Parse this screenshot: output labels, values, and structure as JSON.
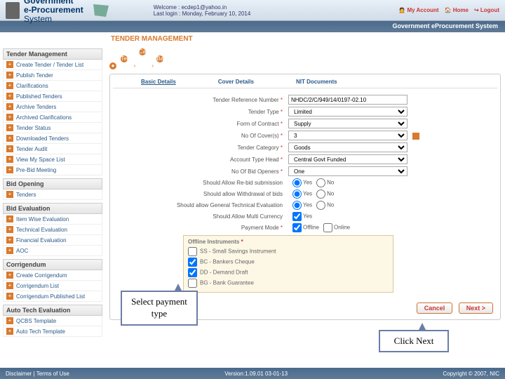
{
  "header": {
    "brand_l1": "Government",
    "brand_l2": "e-Procurement",
    "brand_l3": "System",
    "welcome_lbl": "Welcome",
    "welcome_val": "ecdep1@yahoo.in",
    "lastlogin_lbl": "Last login",
    "lastlogin_val": "Monday, February 10, 2014",
    "links": {
      "acct": "My Account",
      "home": "Home",
      "logout": "Logout"
    },
    "subhead": "Government eProcurement System"
  },
  "page_title": "TENDER MANAGEMENT",
  "sidebar": {
    "groups": [
      {
        "title": "Tender Management",
        "items": [
          "Create Tender / Tender List",
          "Publish Tender",
          "Clarifications",
          "Published Tenders",
          "Archive Tenders",
          "Archived Clarifications",
          "Tender Status",
          "Downloaded Tenders",
          "Tender Audit",
          "View My Space List",
          "Pre-Bid Meeting"
        ]
      },
      {
        "title": "Bid Opening",
        "items": [
          "Tenders"
        ]
      },
      {
        "title": "Bid Evaluation",
        "items": [
          "Item Wise Evaluation",
          "Technical Evaluation",
          "Financial Evaluation",
          "AOC"
        ]
      },
      {
        "title": "Corrigendum",
        "items": [
          "Create Corrigendum",
          "Corrigendum List",
          "Corrigendum Published List"
        ]
      },
      {
        "title": "Auto Tech Evaluation",
        "items": [
          "QCBS Template",
          "Auto Tech Template"
        ]
      }
    ]
  },
  "breadcrumb": [
    "Tender List",
    "Call For Tender",
    "Basic Details"
  ],
  "tabs": [
    "Basic Details",
    "Cover Details",
    "NIT Documents"
  ],
  "form": {
    "ref_lbl": "Tender Reference Number",
    "ref_val": "NHDC/2/C/949/14/0197-02.10",
    "type_lbl": "Tender Type",
    "type_val": "Limited",
    "contract_lbl": "Form of Contract",
    "contract_val": "Supply",
    "covers_lbl": "No Of Cover(s)",
    "covers_val": "3",
    "cat_lbl": "Tender Category",
    "cat_val": "Goods",
    "acct_lbl": "Account Type Head",
    "acct_val": "Central Govt Funded",
    "openers_lbl": "No Of Bid Openers",
    "openers_val": "One",
    "resub_lbl": "Should Allow Re-bid submission",
    "opt_yes": "Yes",
    "opt_no": "No",
    "withdraw_lbl": "Should allow Withdrawal of bids",
    "genteval_lbl": "Should allow General Technical Evaluation",
    "multicur_lbl": "Should Allow Multi Currency",
    "pmode_lbl": "Payment Mode",
    "pmode_off": "Offline",
    "pmode_on": "Online",
    "offline_head": "Offline Instruments",
    "offline_opts": [
      "SS - Small Savings Instrument",
      "BC - Bankers Cheque",
      "DD - Demand Draft",
      "BG - Bank Guarantee"
    ]
  },
  "buttons": {
    "cancel": "Cancel",
    "next": "Next >"
  },
  "callouts": {
    "c1": "Select payment type",
    "c2": "Click Next"
  },
  "footer": {
    "left": "Disclaimer  |  Terms of Use",
    "mid": "Version:1.09.01 03-01-13",
    "right": "Copyright © 2007, NIC"
  }
}
